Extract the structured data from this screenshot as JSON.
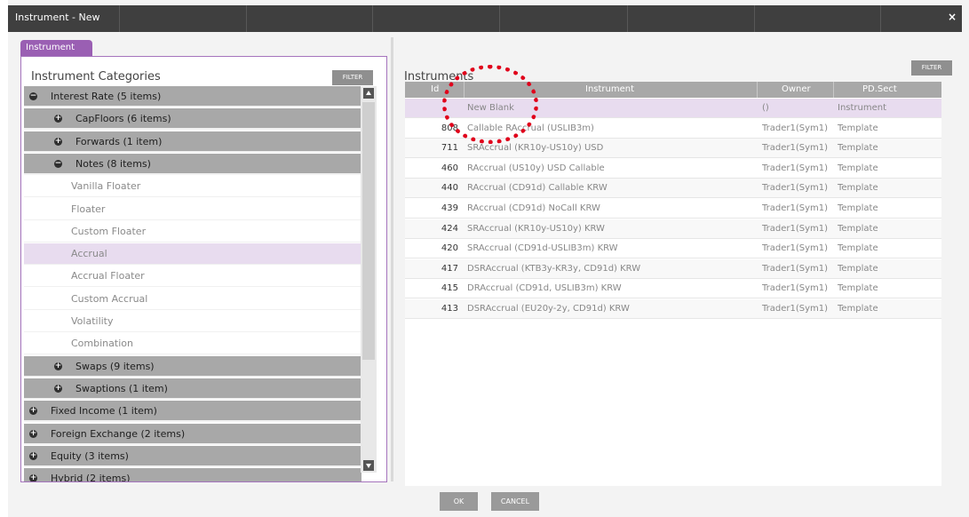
{
  "window": {
    "title": "Instrument - New",
    "close": "×"
  },
  "tab": {
    "label": "Instrument"
  },
  "categories": {
    "title": "Instrument Categories",
    "filter": "FILTER",
    "rows": [
      {
        "type": "group",
        "level": 1,
        "icon": "minus",
        "label": "Interest Rate (5 items)"
      },
      {
        "type": "group",
        "level": 2,
        "icon": "plus",
        "label": "CapFloors (6 items)"
      },
      {
        "type": "group",
        "level": 2,
        "icon": "plus",
        "label": "Forwards (1 item)"
      },
      {
        "type": "group",
        "level": 2,
        "icon": "minus",
        "label": "Notes (8 items)"
      },
      {
        "type": "leaf",
        "label": "Vanilla Floater"
      },
      {
        "type": "leaf",
        "label": "Floater"
      },
      {
        "type": "leaf",
        "label": "Custom Floater"
      },
      {
        "type": "leaf",
        "label": "Accrual",
        "selected": true
      },
      {
        "type": "leaf",
        "label": "Accrual Floater"
      },
      {
        "type": "leaf",
        "label": "Custom Accrual"
      },
      {
        "type": "leaf",
        "label": "Volatility"
      },
      {
        "type": "leaf",
        "label": "Combination"
      },
      {
        "type": "group",
        "level": 2,
        "icon": "plus",
        "label": "Swaps (9 items)"
      },
      {
        "type": "group",
        "level": 2,
        "icon": "plus",
        "label": "Swaptions (1 item)"
      },
      {
        "type": "group",
        "level": 1,
        "icon": "plus",
        "label": "Fixed Income (1 item)"
      },
      {
        "type": "group",
        "level": 1,
        "icon": "plus",
        "label": "Foreign Exchange (2 items)"
      },
      {
        "type": "group",
        "level": 1,
        "icon": "plus",
        "label": "Equity (3 items)"
      },
      {
        "type": "group",
        "level": 1,
        "icon": "plus",
        "label": "Hybrid (2 items)"
      }
    ]
  },
  "instruments": {
    "title": "Instruments",
    "filter": "FILTER",
    "columns": {
      "id": "Id",
      "instrument": "Instrument",
      "owner": "Owner",
      "pd": "PD.Sect"
    },
    "rows": [
      {
        "id": "",
        "name": "New Blank",
        "owner": "()",
        "pd": "Instrument",
        "selected": true
      },
      {
        "id": "808",
        "name": "Callable RAccrual (USLIB3m)",
        "owner": "Trader1(Sym1)",
        "pd": "Template"
      },
      {
        "id": "711",
        "name": "SRAccrual (KR10y-US10y) USD",
        "owner": "Trader1(Sym1)",
        "pd": "Template"
      },
      {
        "id": "460",
        "name": "RAccrual (US10y) USD Callable",
        "owner": "Trader1(Sym1)",
        "pd": "Template"
      },
      {
        "id": "440",
        "name": "RAccrual (CD91d) Callable KRW",
        "owner": "Trader1(Sym1)",
        "pd": "Template"
      },
      {
        "id": "439",
        "name": "RAccrual (CD91d) NoCall KRW",
        "owner": "Trader1(Sym1)",
        "pd": "Template"
      },
      {
        "id": "424",
        "name": "SRAccrual (KR10y-US10y) KRW",
        "owner": "Trader1(Sym1)",
        "pd": "Template"
      },
      {
        "id": "420",
        "name": "SRAccrual (CD91d-USLIB3m) KRW",
        "owner": "Trader1(Sym1)",
        "pd": "Template"
      },
      {
        "id": "417",
        "name": "DSRAccrual (KTB3y-KR3y, CD91d) KRW",
        "owner": "Trader1(Sym1)",
        "pd": "Template"
      },
      {
        "id": "415",
        "name": "DRAccrual (CD91d, USLIB3m) KRW",
        "owner": "Trader1(Sym1)",
        "pd": "Template"
      },
      {
        "id": "413",
        "name": "DSRAccrual (EU20y-2y, CD91d) KRW",
        "owner": "Trader1(Sym1)",
        "pd": "Template"
      }
    ]
  },
  "buttons": {
    "ok": "OK",
    "cancel": "CANCEL"
  },
  "colors": {
    "accent": "#9a5fb3",
    "selection": "#e8dcef",
    "highlight_circle": "#e0001b",
    "titlebar": "#3f3f3f"
  }
}
